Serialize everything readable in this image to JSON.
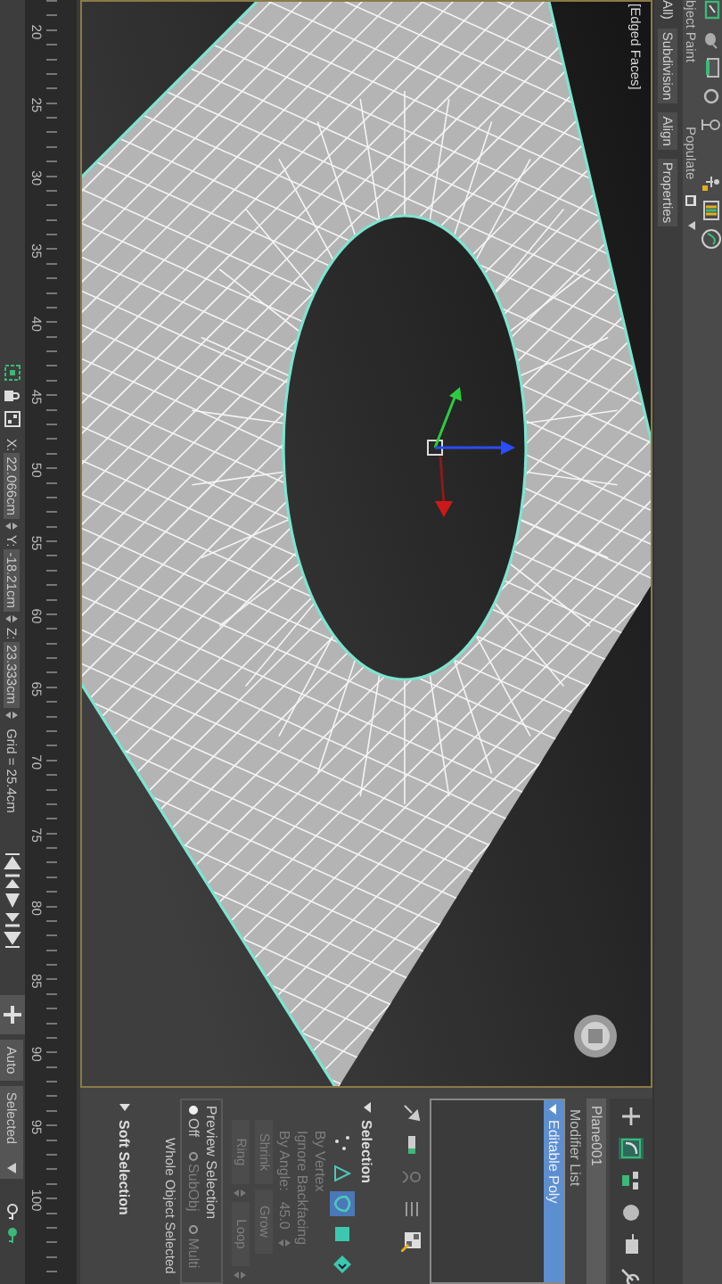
{
  "ribbon": {
    "tabs": [
      {
        "label": "bject Paint"
      },
      {
        "label": "Populate"
      }
    ],
    "panels": [
      {
        "label": "All)"
      },
      {
        "label": "Subdivision"
      },
      {
        "label": "Align"
      },
      {
        "label": "Properties"
      }
    ]
  },
  "viewport": {
    "label": "[Edged Faces]"
  },
  "command_panel": {
    "tabs": [
      {
        "kind": "create",
        "selected": false
      },
      {
        "kind": "modify",
        "selected": true
      },
      {
        "kind": "hierarchy",
        "selected": false
      },
      {
        "kind": "motion",
        "selected": false
      },
      {
        "kind": "display",
        "selected": false
      },
      {
        "kind": "utilities",
        "selected": false
      }
    ],
    "object_name": "Plane001",
    "modifier_list": "Modifier List",
    "stack": [
      {
        "label": "Editable Poly",
        "selected": true,
        "expanded": true
      }
    ],
    "selection": {
      "title": "Selection",
      "expanded": true,
      "levels": [
        {
          "kind": "vertex",
          "selected": false
        },
        {
          "kind": "edge",
          "selected": false
        },
        {
          "kind": "border",
          "selected": true
        },
        {
          "kind": "polygon",
          "selected": false
        },
        {
          "kind": "element",
          "selected": false
        }
      ],
      "options": [
        {
          "label": "By Vertex",
          "disabled": true
        },
        {
          "label": "Ignore Backfacing",
          "disabled": true
        },
        {
          "label": "By Angle:",
          "disabled": true,
          "value": "45.0"
        }
      ],
      "button_rows": [
        [
          {
            "label": "Shrink",
            "spinner": false
          },
          {
            "label": "Grow",
            "spinner": false
          }
        ],
        [
          {
            "label": "Ring",
            "spinner": true
          },
          {
            "label": "Loop",
            "spinner": true
          }
        ]
      ],
      "preview": {
        "title": "Preview Selection",
        "options": [
          {
            "label": "Off",
            "selected": true
          },
          {
            "label": "SubObj",
            "selected": false
          },
          {
            "label": "Multi",
            "selected": false
          }
        ]
      },
      "status": "Whole Object Selected"
    },
    "soft_selection": {
      "title": "Soft Selection",
      "expanded": false
    }
  },
  "timeline": {
    "ticks": [
      "20",
      "25",
      "30",
      "35",
      "40",
      "45",
      "50",
      "55",
      "60",
      "65",
      "70",
      "75",
      "80",
      "85",
      "90",
      "95",
      "100"
    ]
  },
  "status_bar": {
    "coordinates": [
      {
        "axis": "X:",
        "value": "22.066cm"
      },
      {
        "axis": "Y:",
        "value": "-18.21cm"
      },
      {
        "axis": "Z:",
        "value": "23.333cm"
      }
    ],
    "grid": "Grid = 25.4cm",
    "key_mode": "Auto",
    "key_filter": "Selected"
  }
}
